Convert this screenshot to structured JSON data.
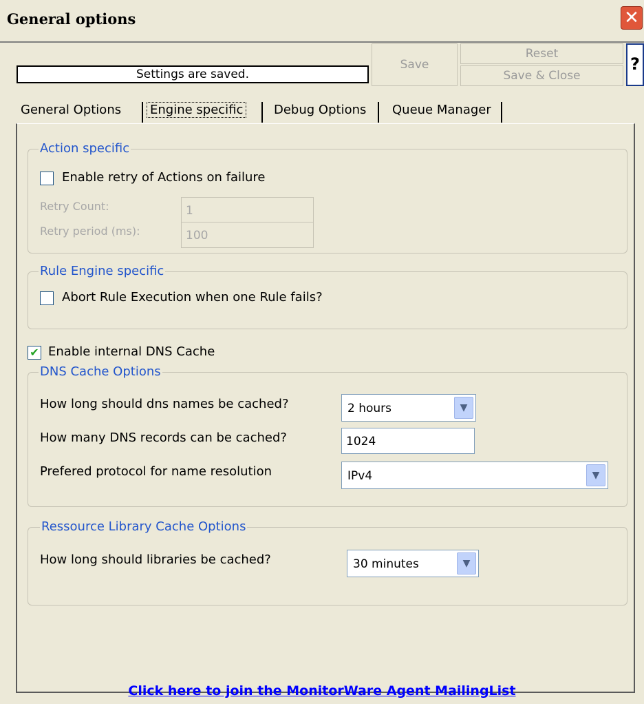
{
  "window": {
    "title": "General options",
    "close_icon": "close-icon"
  },
  "status": "Settings are saved.",
  "toolbar": {
    "save_label": "Save",
    "reset_label": "Reset",
    "save_close_label": "Save & Close",
    "help_label": "?"
  },
  "tabs": [
    {
      "label": "General Options",
      "selected": false
    },
    {
      "label": "Engine specific",
      "selected": true
    },
    {
      "label": "Debug Options",
      "selected": false
    },
    {
      "label": "Queue Manager",
      "selected": false
    }
  ],
  "action_specific": {
    "legend": "Action specific",
    "enable_retry_label": "Enable retry of Actions on failure",
    "enable_retry_checked": false,
    "retry_count_label": "Retry Count:",
    "retry_count_value": "1",
    "retry_period_label": "Retry period (ms):",
    "retry_period_value": "100"
  },
  "rule_engine": {
    "legend": "Rule Engine specific",
    "abort_label": "Abort Rule Execution when one Rule fails?",
    "abort_checked": false
  },
  "dns": {
    "enable_label": "Enable internal DNS Cache",
    "enable_checked": true,
    "legend": "DNS Cache Options",
    "cache_time_label": "How long should dns names be cached?",
    "cache_time_value": "2 hours",
    "records_label": "How many DNS records can be cached?",
    "records_value": "1024",
    "protocol_label": "Prefered protocol for name resolution",
    "protocol_value": "IPv4"
  },
  "resource_library": {
    "legend": "Ressource Library Cache Options",
    "cache_time_label": "How long should libraries be cached?",
    "cache_time_value": "30 minutes"
  },
  "footer_link": "Click here to join the MonitorWare Agent MailingList",
  "colors": {
    "background": "#ECE9D8",
    "legend_blue": "#2255cc",
    "link_blue": "#0000ff",
    "close_red": "#E0573A",
    "check_green": "#21a121"
  }
}
